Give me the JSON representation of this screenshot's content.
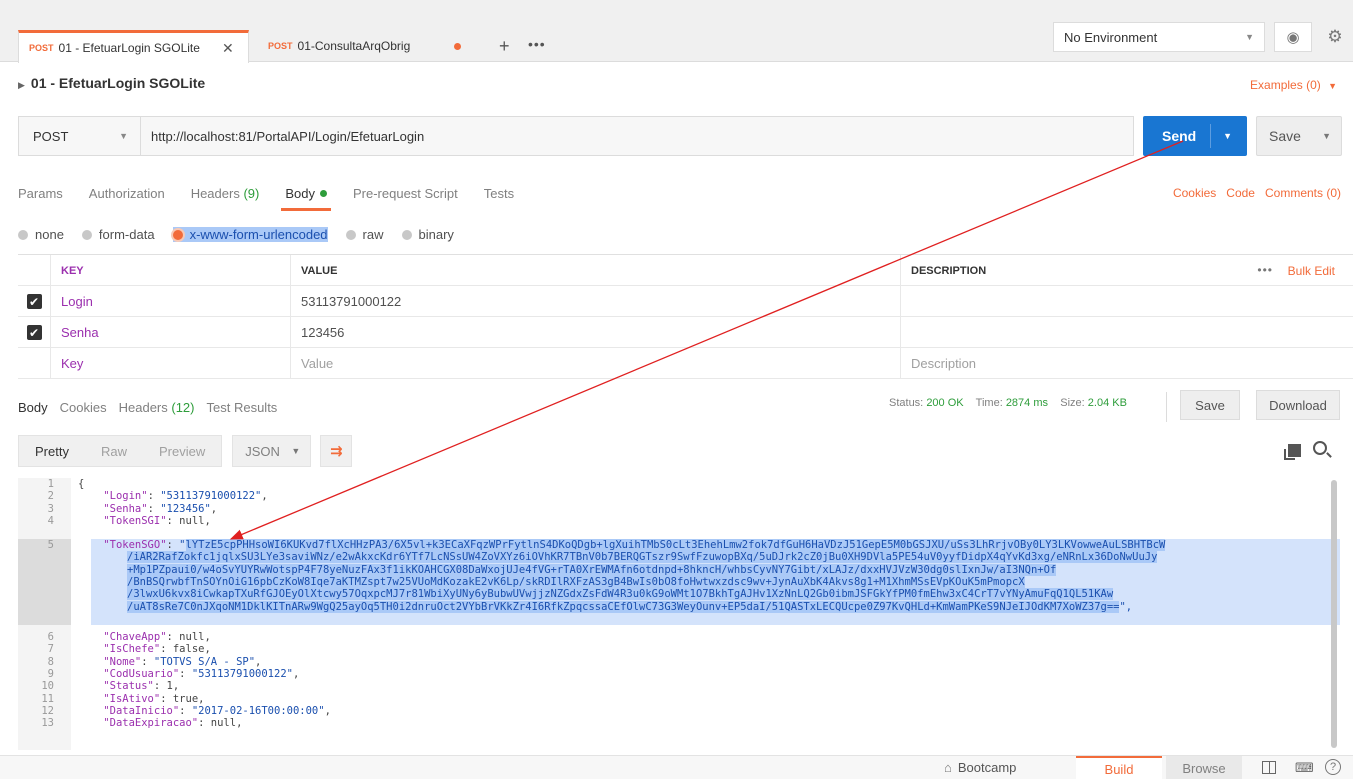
{
  "tabs": [
    {
      "method": "POST",
      "label": "01 - EfetuarLogin SGOLite",
      "close": "✕"
    },
    {
      "method": "POST",
      "label": "01-ConsultaArqObrig"
    }
  ],
  "tab_actions": {
    "add": "+",
    "more": "•••"
  },
  "environment": {
    "selected": "No Environment"
  },
  "request": {
    "name": "01 - EfetuarLogin SGOLite",
    "examples_label": "Examples (0)",
    "method": "POST",
    "url": "http://localhost:81/PortalAPI/Login/EfetuarLogin",
    "send_label": "Send",
    "save_label": "Save"
  },
  "request_tabs": {
    "params": "Params",
    "authorization": "Authorization",
    "headers": "Headers",
    "headers_count": "(9)",
    "body": "Body",
    "prerequest": "Pre-request Script",
    "tests": "Tests"
  },
  "request_links": {
    "cookies": "Cookies",
    "code": "Code",
    "comments": "Comments (0)"
  },
  "body_types": {
    "none": "none",
    "formdata": "form-data",
    "urlencoded": "x-www-form-urlencoded",
    "raw": "raw",
    "binary": "binary"
  },
  "params_table": {
    "headers": {
      "key": "KEY",
      "value": "VALUE",
      "description": "DESCRIPTION"
    },
    "bulk_edit": "Bulk Edit",
    "more": "•••",
    "rows": [
      {
        "checked": "✔",
        "key": "Login",
        "value": "53113791000122"
      },
      {
        "checked": "✔",
        "key": "Senha",
        "value": "123456"
      }
    ],
    "placeholders": {
      "key": "Key",
      "value": "Value",
      "description": "Description"
    }
  },
  "response_tabs": {
    "body": "Body",
    "cookies": "Cookies",
    "headers": "Headers",
    "headers_count": "(12)",
    "test_results": "Test Results"
  },
  "response_status": {
    "status_label": "Status:",
    "status_value": "200 OK",
    "time_label": "Time:",
    "time_value": "2874 ms",
    "size_label": "Size:",
    "size_value": "2.04 KB"
  },
  "response_actions": {
    "save": "Save",
    "download": "Download"
  },
  "format_bar": {
    "pretty": "Pretty",
    "raw": "Raw",
    "preview": "Preview",
    "language": "JSON"
  },
  "code_lines": {
    "l1": "{",
    "l2_key": "\"Login\"",
    "l2_val": "\"53113791000122\"",
    "l3_key": "\"Senha\"",
    "l3_val": "\"123456\"",
    "l4_key": "\"TokenSGI\"",
    "l4_val": "null",
    "l5_key": "\"TokenSGO\"",
    "l5_a": "lYTzE5cpPHHsoWI6KUKvd7flXcHHzPA3/6X5vl+k3ECaXFqzWPrFytlnS4DKoQDgb+lgXuihTMbS0cLt3EhehLmw2fok7dfGuH6HaVDzJ51GepE5M0bGSJXU/uSs3LhRrjvOBy0LY3LKVowweAuLSBHTBcW",
    "l5_b": "/iAR2RafZokfc1jqlxSU3LYe3saviWNz/e2wAkxcKdr6YTf7LcNSsUW4ZoVXYz6iOVhKR7TBnV0b7BERQGTszr9SwfFzuwopBXq/5uDJrk2cZ0jBu0XH9DVla5PE54uV0yyfDidpX4qYvKd3xg/eNRnLx36DoNwUuJy",
    "l5_c": "+Mp1PZpaui0/w4oSvYUYRwWotspP4F78yeNuzFAx3f1ikKOAHCGX08DaWxojUJe4fVG+rTA0XrEWMAfn6otdnpd+8hkncH/whbsCyvNY7Gibt/xLAJz/dxxHVJVzW30dg0slIxnJw/aI3NQn+Of",
    "l5_d": "/BnBSQrwbfTnSOYnOiG16pbCzKoW8Iqe7aKTMZspt7w25VUoMdKozakE2vK6Lp/skRDIlRXFzAS3gB4BwIs0bO8foHwtwxzdsc9wv+JynAuXbK4Akvs8g1+M1XhmMSsEVpKOuK5mPmopcX",
    "l5_e": "/3lwxU6kvx8iCwkapTXuRfGJOEyOlXtcwy57OqxpcMJ7r81WbiXyUNy6yBubwUVwjjzNZGdxZsFdW4R3u0kG9oWMt1O7BkhTgAJHv1XzNnLQ2Gb0ibmJSFGkYfPM0fmEhw3xC4CrT7vYNyAmuFqQ1QL51KAw",
    "l5_f": "/uAT8sRe7C0nJXqoNM1DklKITnARw9WgQ25ayOq5TH0i2dnruOct2VYbBrVKkZr4I6RfkZpqcssaCEfOlwC73G3WeyOunv+EP5daI/51QASTxLECQUcpe0Z97KvQHLd+KmWamPKeS9NJeIJOdKM7XoWZ37g==",
    "l5_end": "\",",
    "l6_key": "\"ChaveApp\"",
    "l6_val": "null",
    "l7_key": "\"IsChefe\"",
    "l7_val": "false",
    "l8_key": "\"Nome\"",
    "l8_val": "\"TOTVS S/A - SP\"",
    "l9_key": "\"CodUsuario\"",
    "l9_val": "\"53113791000122\"",
    "l10_key": "\"Status\"",
    "l10_val": "1",
    "l11_key": "\"IsAtivo\"",
    "l11_val": "true",
    "l12_key": "\"DataInicio\"",
    "l12_val": "\"2017-02-16T00:00:00\"",
    "l13_key": "\"DataExpiracao\"",
    "l13_val": "null"
  },
  "line_numbers": [
    "1",
    "2",
    "3",
    "4",
    "5",
    "6",
    "7",
    "8",
    "9",
    "10",
    "11",
    "12",
    "13"
  ],
  "statusbar": {
    "bootcamp": "Bootcamp",
    "build": "Build",
    "browse": "Browse",
    "help": "?"
  },
  "colors": {
    "accent": "#f26b3a",
    "send": "#1976d2",
    "ok": "#2e9d3b",
    "arrow": "#e02020"
  }
}
